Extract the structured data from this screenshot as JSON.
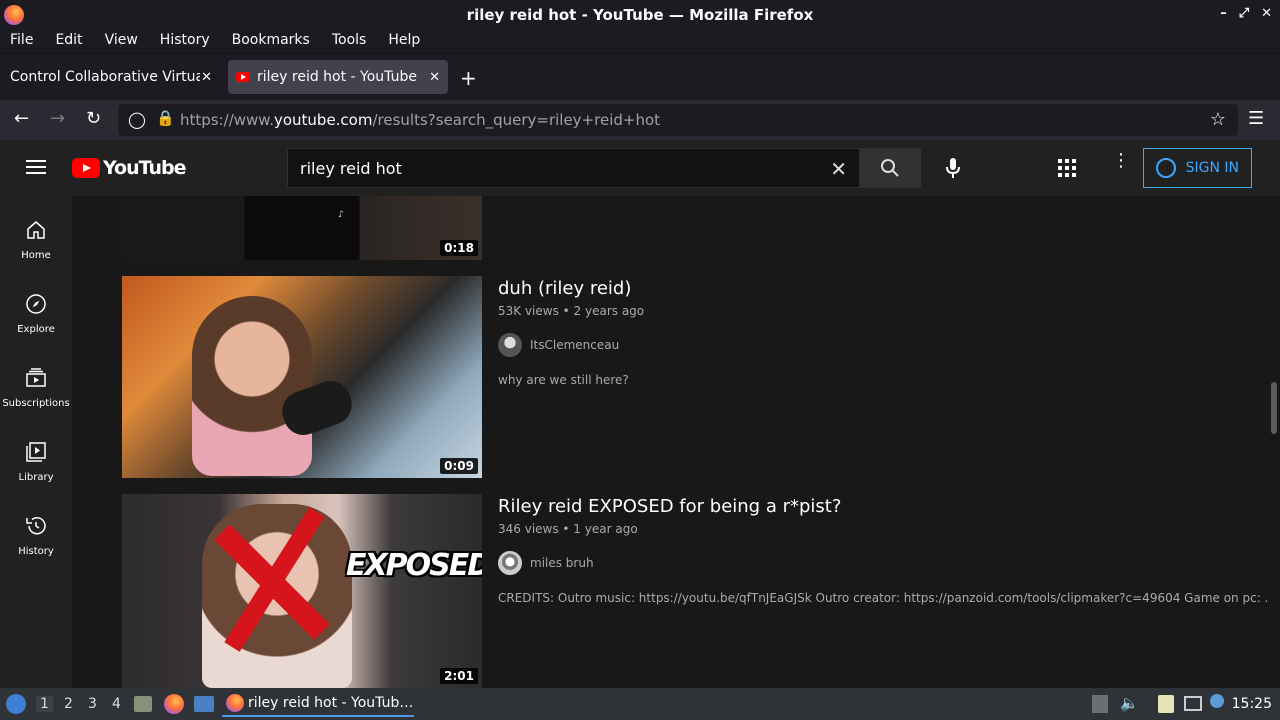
{
  "window": {
    "title": "riley reid hot - YouTube — Mozilla Firefox"
  },
  "menu": [
    "File",
    "Edit",
    "View",
    "History",
    "Bookmarks",
    "Tools",
    "Help"
  ],
  "tabs": [
    {
      "label": "Control Collaborative Virtual"
    },
    {
      "label": "riley reid hot - YouTube"
    }
  ],
  "url": {
    "prefix": "https://www.",
    "domain": "youtube.com",
    "rest": "/results?search_query=riley+reid+hot"
  },
  "youtube": {
    "logo": "YouTube",
    "search_value": "riley reid hot",
    "signin": "SIGN IN",
    "sidebar": [
      {
        "label": "Home"
      },
      {
        "label": "Explore"
      },
      {
        "label": "Subscriptions"
      },
      {
        "label": "Library"
      },
      {
        "label": "History"
      }
    ],
    "videos": [
      {
        "duration": "0:18"
      },
      {
        "title": "duh (riley reid)",
        "meta": "53K views • 2 years ago",
        "channel": "ItsClemenceau",
        "desc": "why are we still here?",
        "duration": "0:09"
      },
      {
        "title": "Riley reid EXPOSED for being a r*pist?",
        "meta": "346 views • 1 year ago",
        "channel": "miles bruh",
        "desc": "CREDITS: Outro music: https://youtu.be/qfTnJEaGJSk Outro creator: https://panzoid.com/tools/clipmaker?c=49604 Game on pc: ...",
        "duration": "2:01",
        "overlay": "EXPOSED?"
      }
    ]
  },
  "taskbar": {
    "workspaces": [
      "1",
      "2",
      "3",
      "4"
    ],
    "task": "riley reid hot - YouTub…",
    "clock": "15:25"
  }
}
